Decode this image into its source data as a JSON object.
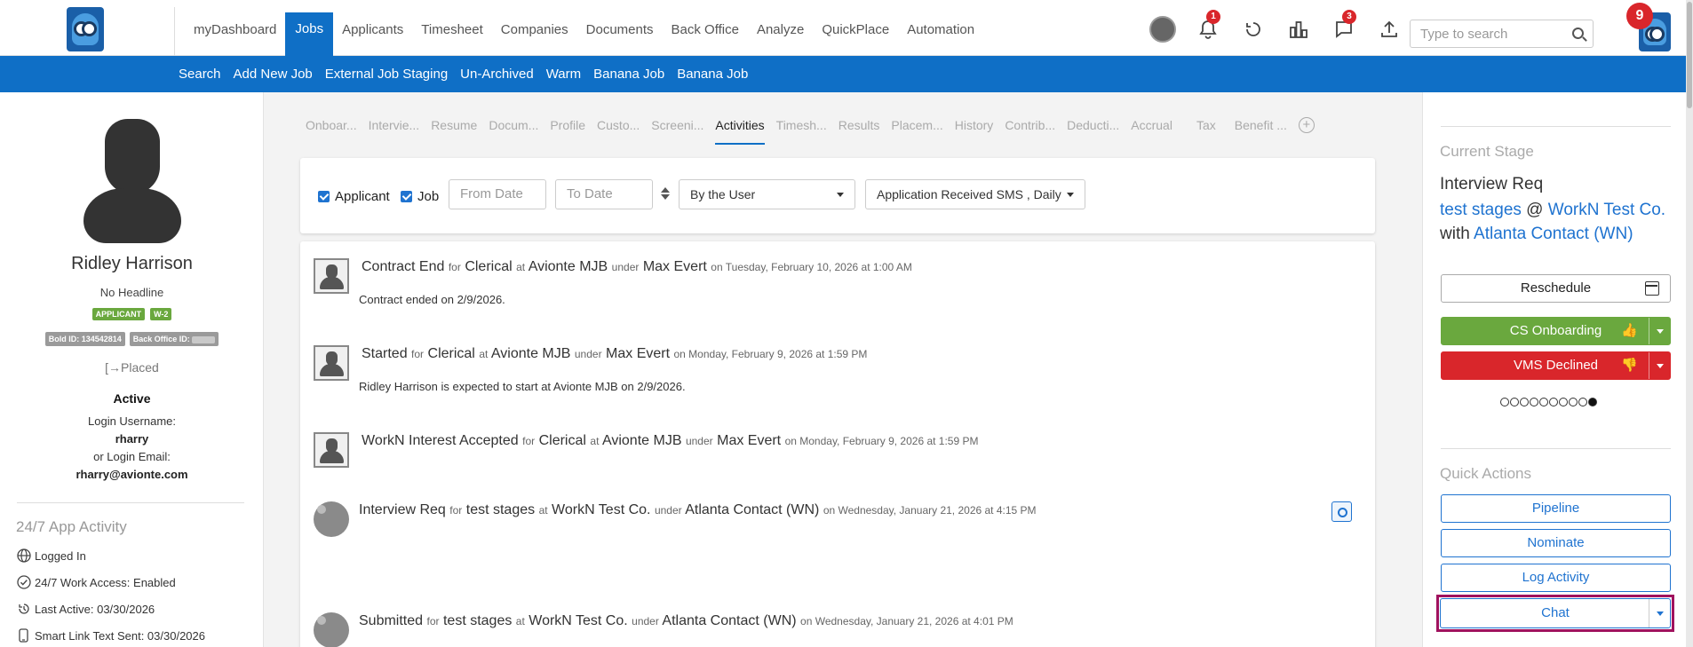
{
  "nav": {
    "items": [
      "myDashboard",
      "Jobs",
      "Applicants",
      "Timesheet",
      "Companies",
      "Documents",
      "Back Office",
      "Analyze",
      "QuickPlace",
      "Automation"
    ],
    "active": "Jobs",
    "notifications_count": "1",
    "messages_count": "3",
    "user_badge": "9",
    "search_placeholder": "Type to search"
  },
  "subnav": {
    "items": [
      "Search",
      "Add New Job",
      "External Job Staging",
      "Un-Archived",
      "Warm",
      "Banana Job",
      "Banana Job"
    ]
  },
  "profile": {
    "name": "Ridley Harrison",
    "headline": "No Headline",
    "tags": [
      "APPLICANT",
      "W-2"
    ],
    "bold_id": "Bold ID: 134542814",
    "back_office_id_label": "Back Office ID:",
    "placed": "Placed",
    "status": "Active",
    "login_username_label": "Login Username:",
    "login_username": "rharry",
    "login_email_label": "or Login Email:",
    "login_email": "rharry@avionte.com",
    "app_activity_title": "24/7 App Activity",
    "activity": [
      {
        "icon": "globe-icon",
        "text": "Logged In"
      },
      {
        "icon": "check-circle-icon",
        "text": "24/7 Work Access: Enabled"
      },
      {
        "icon": "history-icon",
        "text": "Last Active: 03/30/2026"
      },
      {
        "icon": "phone-icon",
        "text": "Smart Link Text Sent: 03/30/2026"
      }
    ]
  },
  "tabs": [
    "Onboar...",
    "Intervie...",
    "Resume",
    "Docum...",
    "Profile",
    "Custo...",
    "Screeni...",
    "Activities",
    "Timesh...",
    "Results",
    "Placem...",
    "History",
    "Contrib...",
    "Deducti...",
    "Accrual",
    "Tax",
    "Benefit ..."
  ],
  "active_tab": "Activities",
  "filters": {
    "applicant_label": "Applicant",
    "job_label": "Job",
    "from_date_placeholder": "From Date",
    "to_date_placeholder": "To Date",
    "sort_by": "By the User",
    "activity_type": "Application Received SMS , Daily"
  },
  "feed": [
    {
      "title": "Contract End",
      "for_label": "for",
      "job": "Clerical",
      "at_label": "at",
      "company": "Avionte MJB",
      "under_label": "under",
      "contact": "Max Evert",
      "date": "on Tuesday, February 10, 2026 at 1:00 AM",
      "text": "Contract ended on 2/9/2026."
    },
    {
      "title": "Started",
      "for_label": "for",
      "job": "Clerical",
      "at_label": "at",
      "company": "Avionte MJB",
      "under_label": "under",
      "contact": "Max Evert",
      "date": "on Monday, February 9, 2026 at 1:59 PM",
      "text": "Ridley Harrison is expected to start at Avionte MJB on 2/9/2026."
    },
    {
      "title": "WorkN Interest Accepted",
      "for_label": "for",
      "job": "Clerical",
      "at_label": "at",
      "company": "Avionte MJB",
      "under_label": "under",
      "contact": "Max Evert",
      "date": "on Monday, February 9, 2026 at 1:59 PM",
      "text": ""
    },
    {
      "title": "Interview Req",
      "for_label": "for",
      "job": "test stages",
      "at_label": "at",
      "company": "WorkN Test Co.",
      "under_label": "under",
      "contact": "Atlanta Contact (WN)",
      "date": "on Wednesday, January 21, 2026 at 4:15 PM",
      "text": ""
    },
    {
      "title": "Submitted",
      "for_label": "for",
      "job": "test stages",
      "at_label": "at",
      "company": "WorkN Test Co.",
      "under_label": "under",
      "contact": "Atlanta Contact (WN)",
      "date": "on Wednesday, January 21, 2026 at 4:01 PM",
      "text": ""
    }
  ],
  "right": {
    "current_stage_title": "Current Stage",
    "stage": "Interview Req",
    "job_link": "test stages",
    "at_word": "@",
    "company_link": "WorkN Test Co.",
    "with_word": "with",
    "contact_link": "Atlanta Contact (WN)",
    "reschedule": "Reschedule",
    "cs_onboarding": "CS Onboarding",
    "vms_declined": "VMS Declined",
    "quick_actions_title": "Quick Actions",
    "pipeline": "Pipeline",
    "nominate": "Nominate",
    "log_activity": "Log Activity",
    "chat": "Chat",
    "colors": {
      "green": "#6aa83e",
      "red": "#d9262b",
      "blue": "#1f73d0",
      "highlight": "#a0125e"
    }
  }
}
